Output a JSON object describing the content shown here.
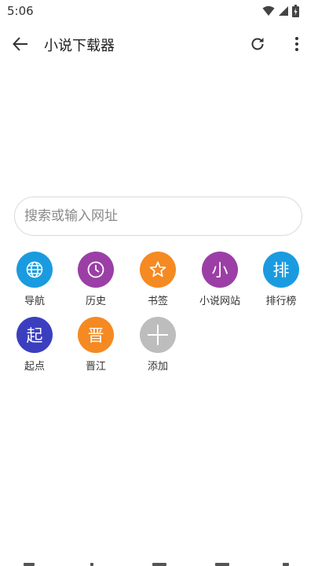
{
  "status_bar": {
    "time": "5:06",
    "icons": [
      "wifi-icon",
      "signal-icon",
      "battery-icon"
    ]
  },
  "app_bar": {
    "title": "小说下载器",
    "icons": [
      "back-arrow-icon",
      "refresh-icon",
      "more-vert-icon"
    ]
  },
  "search": {
    "placeholder": "搜索或输入网址",
    "value": ""
  },
  "shortcuts": [
    {
      "label": "导航",
      "glyph": "",
      "icon": "globe-icon",
      "color": "#1a9be0"
    },
    {
      "label": "历史",
      "glyph": "",
      "icon": "clock-icon",
      "color": "#9b3fa6"
    },
    {
      "label": "书签",
      "glyph": "",
      "icon": "star-icon",
      "color": "#f58a22"
    },
    {
      "label": "小说网站",
      "glyph": "小",
      "icon": "",
      "color": "#9b3fa6"
    },
    {
      "label": "排行榜",
      "glyph": "排",
      "icon": "",
      "color": "#1a9be0"
    },
    {
      "label": "起点",
      "glyph": "起",
      "icon": "",
      "color": "#3b3fbf"
    },
    {
      "label": "晋江",
      "glyph": "晋",
      "icon": "",
      "color": "#f58a22"
    },
    {
      "label": "添加",
      "glyph": "",
      "icon": "plus-icon",
      "color": "#bdbdbd"
    }
  ]
}
